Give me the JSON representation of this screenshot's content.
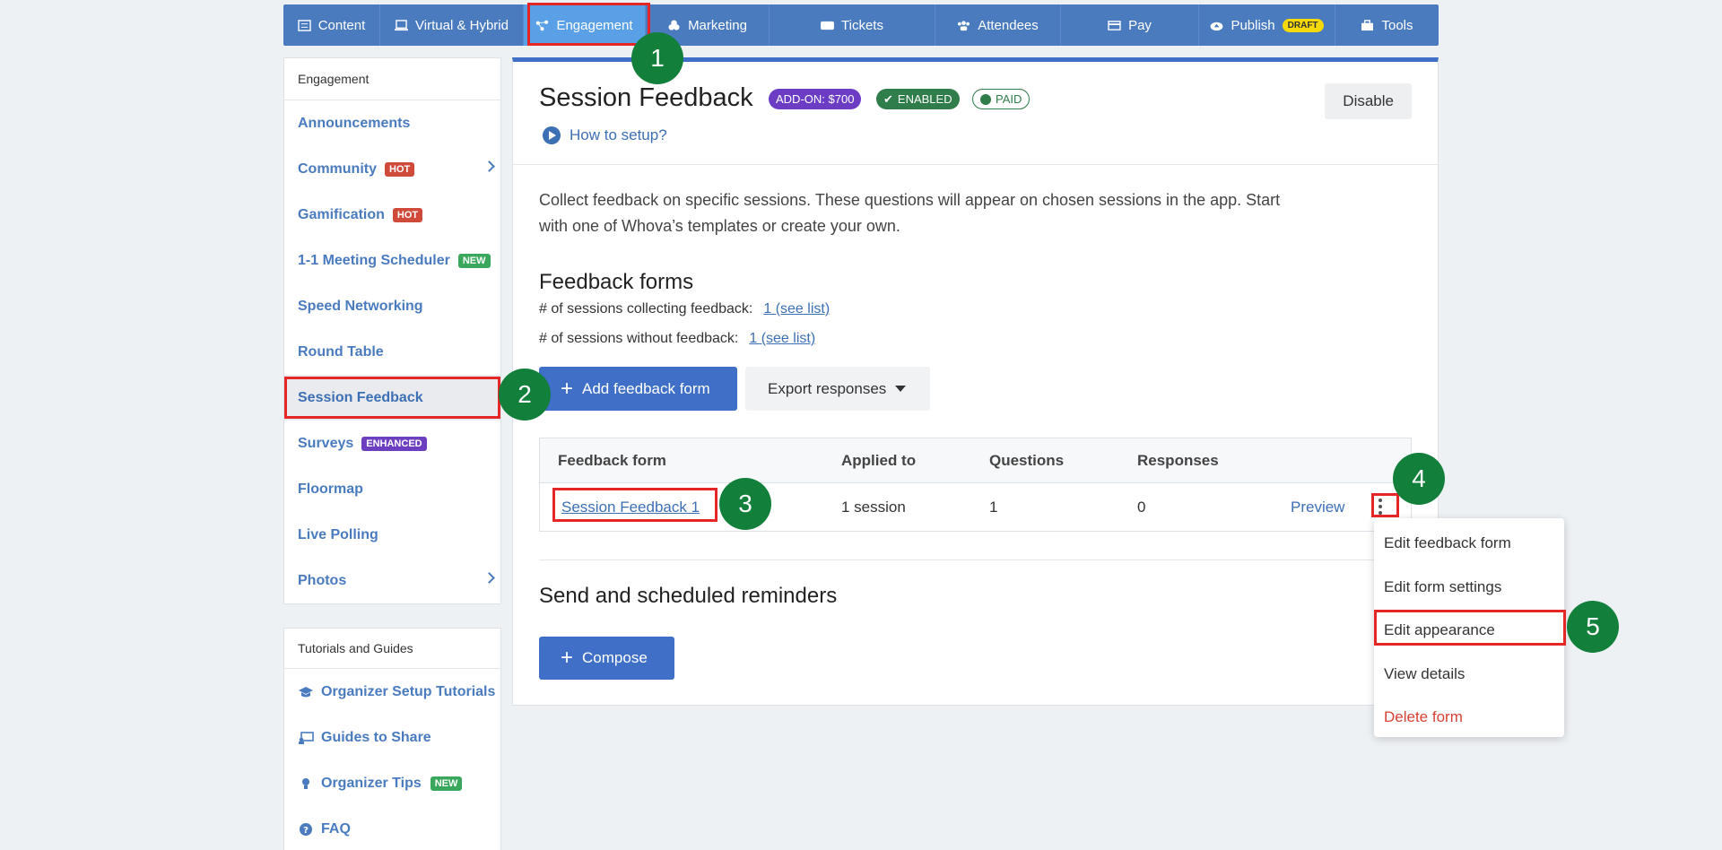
{
  "topnav": [
    {
      "label": "Content",
      "icon": "content-icon"
    },
    {
      "label": "Virtual & Hybrid",
      "icon": "monitor-icon"
    },
    {
      "label": "Engagement",
      "icon": "share-icon",
      "active": true
    },
    {
      "label": "Marketing",
      "icon": "marketing-icon"
    },
    {
      "label": "Tickets",
      "icon": "ticket-icon"
    },
    {
      "label": "Attendees",
      "icon": "people-icon"
    },
    {
      "label": "Pay",
      "icon": "card-icon"
    },
    {
      "label": "Publish",
      "icon": "cloud-upload-icon",
      "badge": "DRAFT"
    },
    {
      "label": "Tools",
      "icon": "toolbox-icon"
    }
  ],
  "sidebar": {
    "heading": "Engagement",
    "items": [
      {
        "label": "Announcements"
      },
      {
        "label": "Community",
        "tag": "HOT"
      },
      {
        "label": "Gamification",
        "tag": "HOT"
      },
      {
        "label": "1-1 Meeting Scheduler",
        "tag": "NEW"
      },
      {
        "label": "Speed Networking"
      },
      {
        "label": "Round Table"
      },
      {
        "label": "Session Feedback",
        "active": true
      },
      {
        "label": "Surveys",
        "tag": "ENHANCED"
      },
      {
        "label": "Floormap"
      },
      {
        "label": "Live Polling"
      },
      {
        "label": "Photos"
      }
    ]
  },
  "tutorials": {
    "heading": "Tutorials and Guides",
    "items": [
      {
        "label": "Organizer Setup Tutorials",
        "icon": "graduation-cap-icon"
      },
      {
        "label": "Guides to Share",
        "icon": "share-screen-icon"
      },
      {
        "label": "Organizer Tips",
        "icon": "lightbulb-icon",
        "tag": "NEW"
      },
      {
        "label": "FAQ",
        "icon": "question-icon"
      }
    ]
  },
  "main": {
    "title": "Session Feedback",
    "addon_pill": "ADD-ON: $700",
    "enabled_pill": "ENABLED",
    "paid_pill": "PAID",
    "howto": "How to setup?",
    "disable_label": "Disable",
    "description": "Collect feedback on specific sessions. These questions will appear on chosen sessions in the app. Start with one of Whova’s templates or create your own.",
    "forms_title": "Feedback forms",
    "stat_collecting_label": "# of sessions collecting feedback:",
    "stat_collecting_link": "1 (see list)",
    "stat_without_label": "# of sessions without feedback:",
    "stat_without_link": "1 (see list)",
    "add_form_label": "Add feedback form",
    "export_label": "Export responses",
    "table": {
      "headers": [
        "Feedback form",
        "Applied to",
        "Questions",
        "Responses"
      ],
      "row": {
        "form": "Session Feedback 1",
        "applied": "1 session",
        "questions": "1",
        "responses": "0",
        "preview": "Preview"
      }
    },
    "reminders_title": "Send and scheduled reminders",
    "compose_label": "Compose"
  },
  "menu": {
    "items": [
      "Edit feedback form",
      "Edit form settings",
      "Edit appearance",
      "View details",
      "Delete form"
    ]
  },
  "steps": [
    "1",
    "2",
    "3",
    "4",
    "5"
  ],
  "colors": {
    "accent": "#3f6fc6",
    "nav": "#4a7bbf",
    "highlight": "#e52626",
    "step": "#127f3b"
  }
}
